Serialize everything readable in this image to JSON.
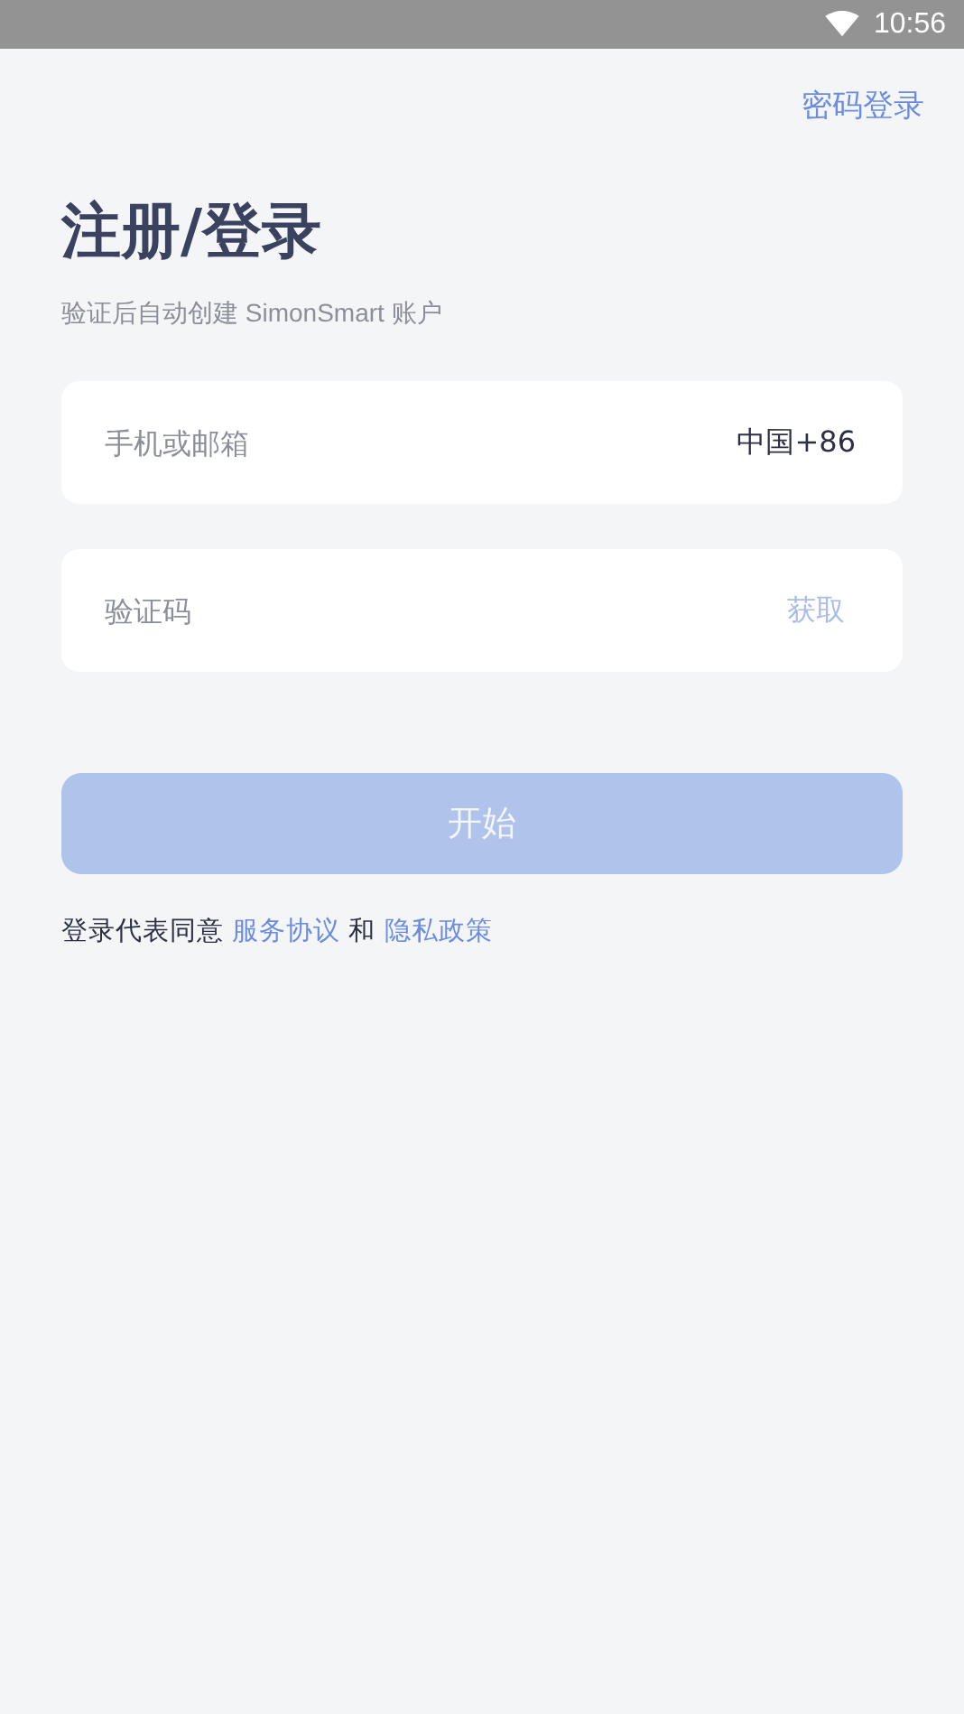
{
  "status_bar": {
    "time": "10:56"
  },
  "top_link": "密码登录",
  "title": "注册/登录",
  "subtitle": "验证后自动创建 SimonSmart 账户",
  "account_field": {
    "placeholder": "手机或邮箱",
    "region": "中国+86"
  },
  "code_field": {
    "placeholder": "验证码",
    "get_code": "获取",
    "get_code_disabled": true
  },
  "start_button": {
    "label": "开始",
    "disabled": true
  },
  "agreement": {
    "text": "登录代表同意",
    "link1": "服务协议",
    "joiner": "和",
    "link2": "隐私政策"
  }
}
